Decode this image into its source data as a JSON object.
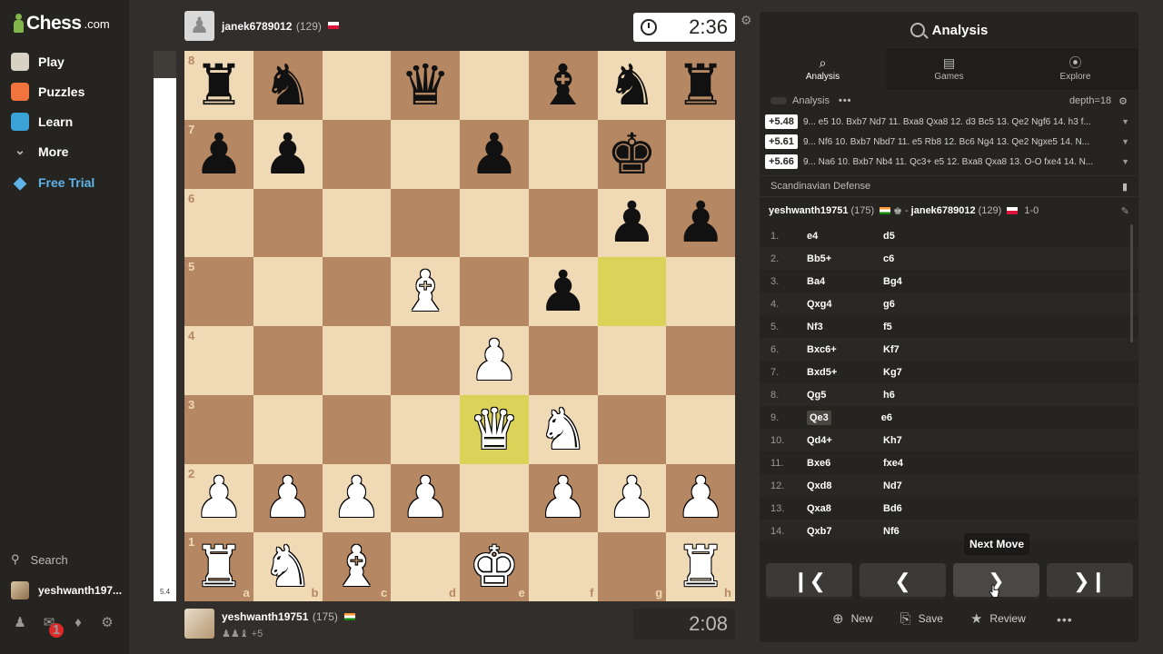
{
  "sidebar": {
    "brand": "Chess",
    "brand_suffix": ".com",
    "items": [
      {
        "label": "Play",
        "icon": "play-pawn-icon",
        "color": "#d8d2c5"
      },
      {
        "label": "Puzzles",
        "icon": "puzzle-icon",
        "color": "#f1743d"
      },
      {
        "label": "Learn",
        "icon": "learn-cap-icon",
        "color": "#3aa2d6"
      },
      {
        "label": "More",
        "icon": "chevron-down-icon",
        "color": "#bababa"
      },
      {
        "label": "Free Trial",
        "icon": "diamond-icon",
        "color": "#5fb3e8"
      }
    ],
    "search_label": "Search",
    "username": "yeshwanth197...",
    "notification_count": "1"
  },
  "eval": {
    "label": "5.4",
    "white_fraction": 0.95
  },
  "top_player": {
    "name": "janek6789012",
    "rating": "(129)",
    "flag": "pl",
    "clock": "2:36"
  },
  "bottom_player": {
    "name": "yeshwanth19751",
    "rating": "(175)",
    "flag": "in",
    "material": "+5",
    "clock": "2:08"
  },
  "board": {
    "files": [
      "a",
      "b",
      "c",
      "d",
      "e",
      "f",
      "g",
      "h"
    ],
    "ranks": [
      "8",
      "7",
      "6",
      "5",
      "4",
      "3",
      "2",
      "1"
    ],
    "highlight": [
      "g5",
      "e3"
    ],
    "pieces": {
      "a8": "bR",
      "b8": "bN",
      "d8": "bQ",
      "f8": "bB",
      "g8": "bN",
      "h8": "bR",
      "a7": "bP",
      "b7": "bP",
      "e7": "bP",
      "g7": "bK",
      "g6": "bP",
      "h6": "bP",
      "d5": "wB",
      "f5": "bP",
      "e4": "wP",
      "e3": "wQ",
      "f3": "wN",
      "a2": "wP",
      "b2": "wP",
      "c2": "wP",
      "d2": "wP",
      "f2": "wP",
      "g2": "wP",
      "h2": "wP",
      "a1": "wR",
      "b1": "wN",
      "c1": "wB",
      "e1": "wK",
      "h1": "wR"
    }
  },
  "panel": {
    "title": "Analysis",
    "tabs": [
      {
        "label": "Analysis",
        "icon": "analysis-icon"
      },
      {
        "label": "Games",
        "icon": "games-icon"
      },
      {
        "label": "Explore",
        "icon": "compass-icon"
      }
    ],
    "analysis_toggle_label": "Analysis",
    "depth": "depth=18",
    "lines": [
      {
        "score": "+5.48",
        "text": "9... e5 10. Bxb7 Nd7 11. Bxa8 Qxa8 12. d3 Bc5 13. Qe2 Ngf6 14. h3 f..."
      },
      {
        "score": "+5.61",
        "text": "9... Nf6 10. Bxb7 Nbd7 11. e5 Rb8 12. Bc6 Ng4 13. Qe2 Ngxe5 14. N..."
      },
      {
        "score": "+5.66",
        "text": "9... Na6 10. Bxb7 Nb4 11. Qc3+ e5 12. Bxa8 Qxa8 13. O-O fxe4 14. N..."
      }
    ],
    "opening": "Scandinavian Defense",
    "game": {
      "white": "yeshwanth19751",
      "white_rating": "(175)",
      "black": "janek6789012",
      "black_rating": "(129)",
      "result": "1-0",
      "separator": "-"
    },
    "moves": [
      {
        "n": "1.",
        "w": "e4",
        "b": "d5"
      },
      {
        "n": "2.",
        "w": "Bb5+",
        "b": "c6"
      },
      {
        "n": "3.",
        "w": "Ba4",
        "b": "Bg4"
      },
      {
        "n": "4.",
        "w": "Qxg4",
        "b": "g6"
      },
      {
        "n": "5.",
        "w": "Nf3",
        "b": "f5"
      },
      {
        "n": "6.",
        "w": "Bxc6+",
        "b": "Kf7"
      },
      {
        "n": "7.",
        "w": "Bxd5+",
        "b": "Kg7"
      },
      {
        "n": "8.",
        "w": "Qg5",
        "b": "h6"
      },
      {
        "n": "9.",
        "w": "Qe3",
        "b": "e6",
        "current": true
      },
      {
        "n": "10.",
        "w": "Qd4+",
        "b": "Kh7"
      },
      {
        "n": "11.",
        "w": "Bxe6",
        "b": "fxe4"
      },
      {
        "n": "12.",
        "w": "Qxd8",
        "b": "Nd7"
      },
      {
        "n": "13.",
        "w": "Qxa8",
        "b": "Bd6"
      },
      {
        "n": "14.",
        "w": "Qxb7",
        "b": "Nf6"
      }
    ],
    "tooltip": "Next Move",
    "actions": [
      {
        "label": "New",
        "icon": "magnifier-plus-icon"
      },
      {
        "label": "Save",
        "icon": "save-icon"
      },
      {
        "label": "Review",
        "icon": "review-star-icon"
      }
    ]
  }
}
